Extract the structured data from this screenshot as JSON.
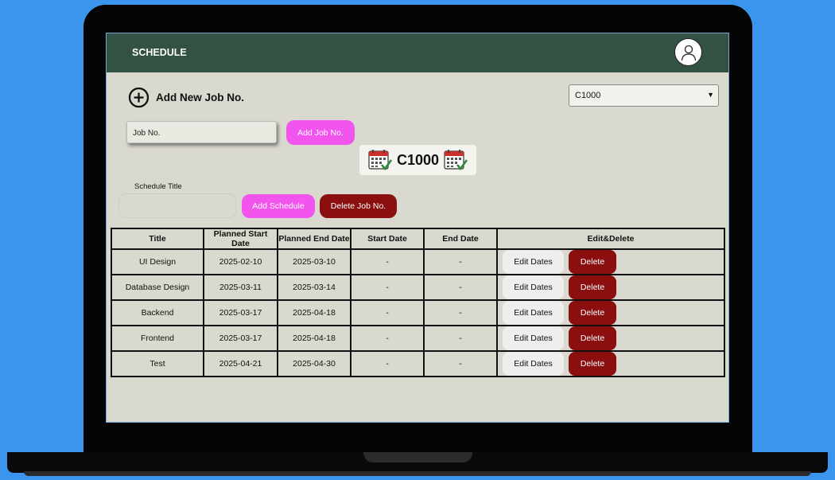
{
  "app": {
    "title": "SCHEDULE"
  },
  "add_job": {
    "heading": "Add New Job No.",
    "input_placeholder": "Job No.",
    "add_button": "Add Job No."
  },
  "job_select": {
    "selected": "C1000"
  },
  "current_job": {
    "code": "C1000"
  },
  "schedule_form": {
    "label": "Schedule Title",
    "input_value": "",
    "add_button": "Add Schedule",
    "delete_job_button": "Delete Job No."
  },
  "table": {
    "headers": [
      "Title",
      "Planned Start Date",
      "Planned End Date",
      "Start Date",
      "End Date",
      "Edit&Delete"
    ],
    "edit_label": "Edit Dates",
    "delete_label": "Delete",
    "rows": [
      [
        "UI Design",
        "2025-02-10",
        "2025-03-10",
        "-",
        "-"
      ],
      [
        "Database Design",
        "2025-03-11",
        "2025-03-14",
        "-",
        "-"
      ],
      [
        "Backend",
        "2025-03-17",
        "2025-04-18",
        "-",
        "-"
      ],
      [
        "Frontend",
        "2025-03-17",
        "2025-04-18",
        "-",
        "-"
      ],
      [
        "Test",
        "2025-04-21",
        "2025-04-30",
        "-",
        "-"
      ]
    ]
  },
  "colors": {
    "header_bg": "#345244",
    "screen_bg": "#dad9cf",
    "pink_button": "#f254ee",
    "danger": "#8b0f0f",
    "page_bg": "#3b95ee"
  },
  "icons": [
    "user-avatar-icon",
    "plus-circle-icon",
    "calendar-check-icon",
    "chevron-down-icon"
  ]
}
